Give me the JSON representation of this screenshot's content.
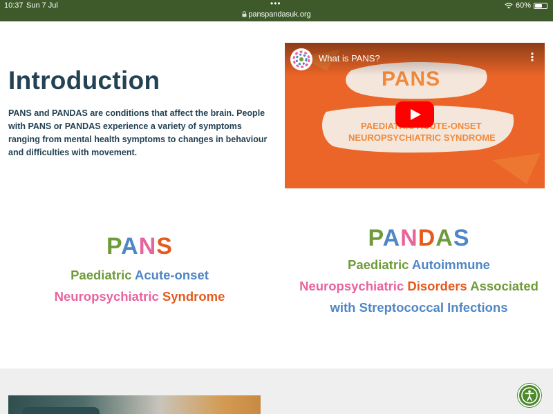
{
  "status_bar": {
    "time": "10:37",
    "date": "Sun 7 Jul",
    "battery": "60%",
    "battery_level": 0.6
  },
  "browser": {
    "url": "panspandasuk.org"
  },
  "intro": {
    "title": "Introduction",
    "text": "PANS and PANDAS are conditions that affect the brain. People with PANS or PANDAS experience a variety of symptoms ranging from mental health symptoms to changes in behaviour and difficulties with movement."
  },
  "video": {
    "title": "What is PANS?",
    "overlay_word": "PANS",
    "overlay_line1": "PAEDIATRIC ACUTE-ONSET",
    "overlay_line2": "NEUROPSYCHIATRIC SYNDROME"
  },
  "pans": {
    "letters": [
      "P",
      "A",
      "N",
      "S"
    ],
    "line1_a": "Paediatric",
    "line1_b": "Acute-onset",
    "line2_a": "Neuropsychiatric",
    "line2_b": "Syndrome"
  },
  "pandas": {
    "letters": [
      "P",
      "A",
      "N",
      "D",
      "A",
      "S"
    ],
    "line1_a": "Paediatric",
    "line1_b": "Autoimmune",
    "line2_a": "Neuropsychiatric",
    "line2_b": "Disorders",
    "line2_c": "Associated",
    "line3_a": "with",
    "line3_b": "Streptococcal",
    "line3_c": "Infections"
  },
  "colors": {
    "topbar": "#3f5a2a",
    "heading": "#234254",
    "green": "#6f9b3a",
    "blue": "#4f86c6",
    "pink": "#e9639d",
    "orange": "#e65a1e",
    "accessibility_button": "#4c8a2c"
  },
  "icons": {
    "lock": "lock-icon",
    "wifi": "wifi-icon",
    "battery": "battery-icon",
    "play": "play-icon",
    "accessibility": "accessibility-icon",
    "more": "more-vertical-icon"
  }
}
